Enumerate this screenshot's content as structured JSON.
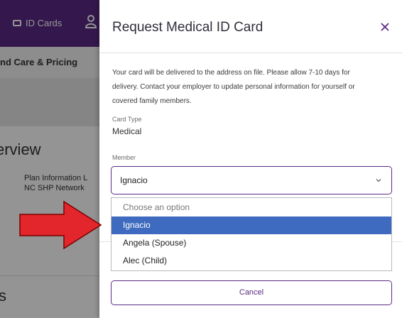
{
  "background": {
    "topbar_id_cards": "ID Cards",
    "section_title": "nd Care & Pricing",
    "overview_heading": "erview",
    "plan_info_line1": "Plan Information L",
    "plan_info_line2": "NC SHP Network",
    "bottom_heading": "s"
  },
  "modal": {
    "title": "Request Medical ID Card",
    "description": "Your card will be delivered to the address on file. Please allow 7-10 days for delivery. Contact your employer to update personal information for yourself or covered family members.",
    "card_type_label": "Card Type",
    "card_type_value": "Medical",
    "member_label": "Member",
    "member_selected": "Ignacio",
    "member_options": [
      {
        "label": "Choose an option"
      },
      {
        "label": "Ignacio"
      },
      {
        "label": "Angela (Spouse)"
      },
      {
        "label": "Alec (Child)"
      }
    ],
    "cancel_label": "Cancel"
  },
  "colors": {
    "brand_purple": "#5b2a86",
    "selected_option": "#3e6bbf",
    "arrow_red": "#e3262b"
  }
}
